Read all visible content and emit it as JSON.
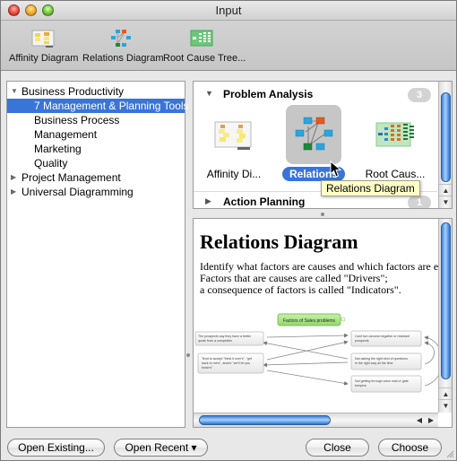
{
  "window": {
    "title": "Input"
  },
  "toolbar": {
    "items": [
      {
        "label": "Affinity Diagram",
        "icon": "affinity-diagram-icon"
      },
      {
        "label": "Relations Diagram",
        "icon": "relations-diagram-icon"
      },
      {
        "label": "Root Cause Tree...",
        "icon": "root-cause-tree-icon"
      }
    ]
  },
  "tree": {
    "items": [
      {
        "label": "Business Productivity",
        "level": 0,
        "expanded": true
      },
      {
        "label": "7 Management & Planning Tools",
        "level": 1,
        "selected": true
      },
      {
        "label": "Business Process",
        "level": 1
      },
      {
        "label": "Management",
        "level": 1
      },
      {
        "label": "Marketing",
        "level": 1
      },
      {
        "label": "Quality",
        "level": 1
      },
      {
        "label": "Project Management",
        "level": 0,
        "expanded": false
      },
      {
        "label": "Universal Diagramming",
        "level": 0,
        "expanded": false
      }
    ],
    "disclosure_open": "▼",
    "disclosure_closed": "▶"
  },
  "gallery": {
    "sections": [
      {
        "name": "Problem Analysis",
        "count": "3",
        "expanded": true,
        "templates": [
          {
            "label": "Affinity Di...",
            "icon": "affinity-diagram-thumbnail"
          },
          {
            "label": "Relations",
            "icon": "relations-diagram-thumbnail",
            "selected": true
          },
          {
            "label": "Root Caus...",
            "icon": "root-cause-tree-thumbnail"
          }
        ]
      },
      {
        "name": "Action Planning",
        "count": "1",
        "expanded": false
      }
    ],
    "tooltip": "Relations Diagram"
  },
  "preview": {
    "title": "Relations Diagram",
    "description": [
      "Identify what factors are causes and which factors are effects.",
      "Factors that are causes are called \"Drivers\";",
      "a consequence of factors is called \"Indicators\"."
    ],
    "diagram": {
      "root": "Factors of Sales problems",
      "nodes": [
        "The prospects say they have a better quote from a competitor",
        "Tend to accept \"think it over's\", \"get back to me's\", and/or \"we'll let you know's\"",
        "Can't turn around negative or resistant prospects",
        "Not asking the right kind of questions in the right way all the time",
        "Not getting through voice mail or gate keepers"
      ]
    }
  },
  "buttons": {
    "open_existing": "Open Existing...",
    "open_recent": "Open Recent ▾",
    "close": "Close",
    "choose": "Choose"
  },
  "colors": {
    "selection": "#3875d7",
    "tooltip_bg": "#ffffc6",
    "root_node": "#a8e08a"
  }
}
